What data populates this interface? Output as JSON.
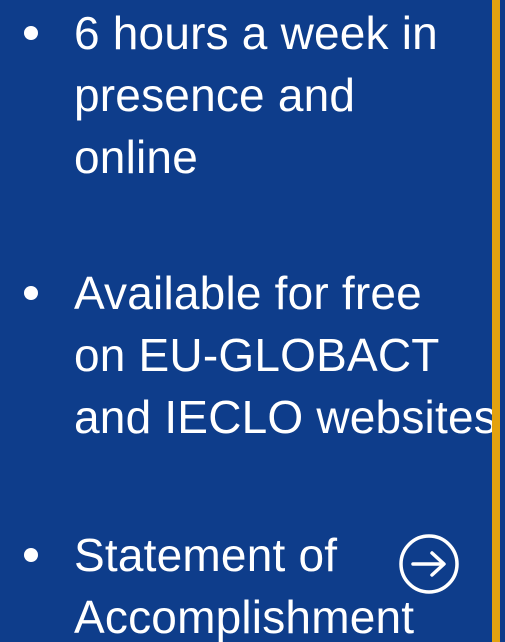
{
  "bullets": [
    {
      "lines": [
        "6 hours a week in",
        "presence and",
        "online"
      ]
    },
    {
      "lines": [
        "Available for free",
        "on EU-GLOBACT",
        "and IECLO websites"
      ]
    },
    {
      "lines": [
        "Statement of",
        "Accomplishment"
      ]
    }
  ],
  "icons": {
    "next": "arrow-right-circle-icon"
  },
  "colors": {
    "background": "#0e3d8b",
    "accent": "#e3a20f",
    "text": "#ffffff"
  }
}
